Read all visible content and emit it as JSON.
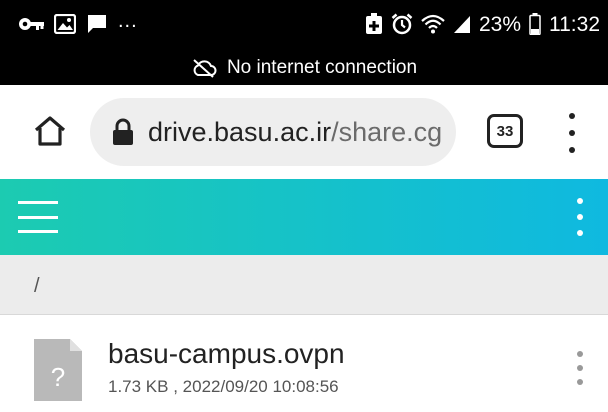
{
  "status_bar": {
    "left_icons": [
      "key-icon",
      "image-icon",
      "message-icon"
    ],
    "ellipsis": "...",
    "right_icons": [
      "battery-saver-icon",
      "alarm-icon",
      "wifi-icon",
      "signal-icon"
    ],
    "battery_percent": "23%",
    "time": "11:32"
  },
  "offline_banner": {
    "icon": "cloud-off-icon",
    "text": "No internet connection"
  },
  "browser": {
    "home_icon": "home-icon",
    "lock_icon": "lock-icon",
    "url_host": "drive.basu.ac.ir",
    "url_path": "/share.cg",
    "tab_count": "33",
    "menu_icon": "more-vert-icon"
  },
  "app_bar": {
    "menu_icon": "hamburger-icon",
    "overflow_icon": "more-vert-icon",
    "colors": {
      "start": "#1ccbb1",
      "end": "#0fb9e0"
    }
  },
  "breadcrumb": {
    "path": "/"
  },
  "files": [
    {
      "icon": "unknown-file-icon",
      "icon_glyph": "?",
      "name": "basu-campus.ovpn",
      "meta": "1.73 KB , 2022/09/20 10:08:56"
    }
  ]
}
